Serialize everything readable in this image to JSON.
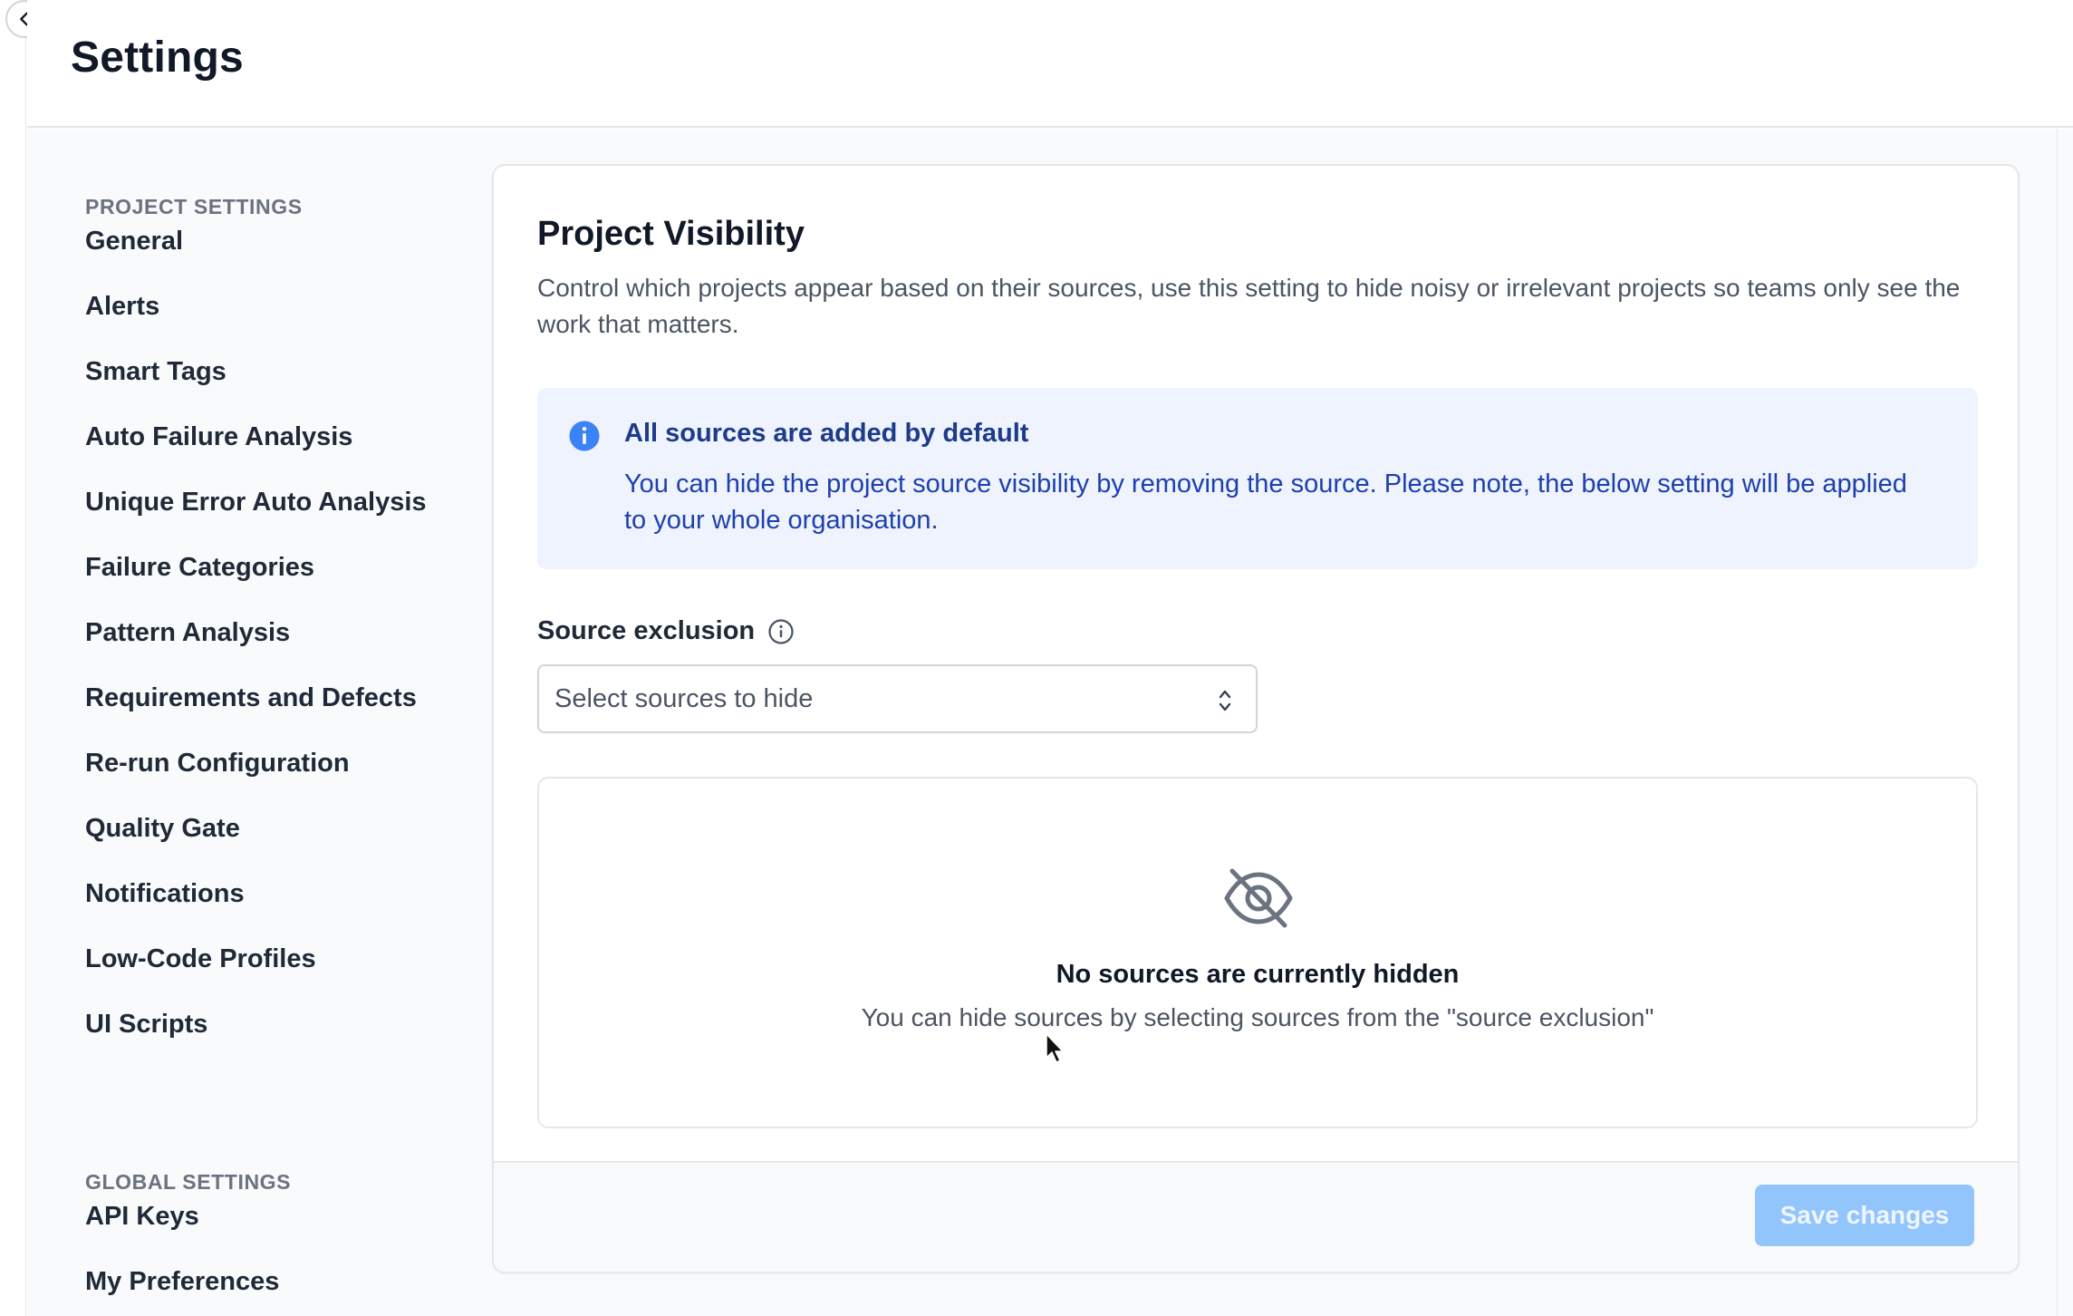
{
  "page": {
    "title": "Settings"
  },
  "sidebar": {
    "project_settings_label": "PROJECT SETTINGS",
    "project_items": [
      {
        "label": "General"
      },
      {
        "label": "Alerts"
      },
      {
        "label": "Smart Tags"
      },
      {
        "label": "Auto Failure Analysis"
      },
      {
        "label": "Unique Error Auto Analysis"
      },
      {
        "label": "Failure Categories"
      },
      {
        "label": "Pattern Analysis"
      },
      {
        "label": "Requirements and Defects"
      },
      {
        "label": "Re-run Configuration"
      },
      {
        "label": "Quality Gate"
      },
      {
        "label": "Notifications"
      },
      {
        "label": "Low-Code Profiles"
      },
      {
        "label": "UI Scripts"
      }
    ],
    "global_settings_label": "GLOBAL SETTINGS",
    "global_items": [
      {
        "label": "API Keys"
      },
      {
        "label": "My Preferences"
      }
    ]
  },
  "card": {
    "title": "Project Visibility",
    "description": "Control which projects appear based on their sources, use this setting to hide noisy or irrelevant projects so teams only see the work that matters.",
    "info": {
      "title": "All sources are added by default",
      "text": "You can hide the project source visibility by removing the source. Please note, the below setting will be applied to your whole organisation."
    },
    "source_exclusion": {
      "label": "Source exclusion",
      "placeholder": "Select sources to hide"
    },
    "empty_state": {
      "title": "No sources are currently hidden",
      "subtitle": "You can hide sources by selecting sources from the \"source exclusion\""
    },
    "footer": {
      "save_label": "Save changes"
    }
  },
  "colors": {
    "accent_disabled": "#93c5fd",
    "info_bg": "#eef3fd",
    "info_text": "#1e40af",
    "info_icon": "#3b82f6"
  }
}
